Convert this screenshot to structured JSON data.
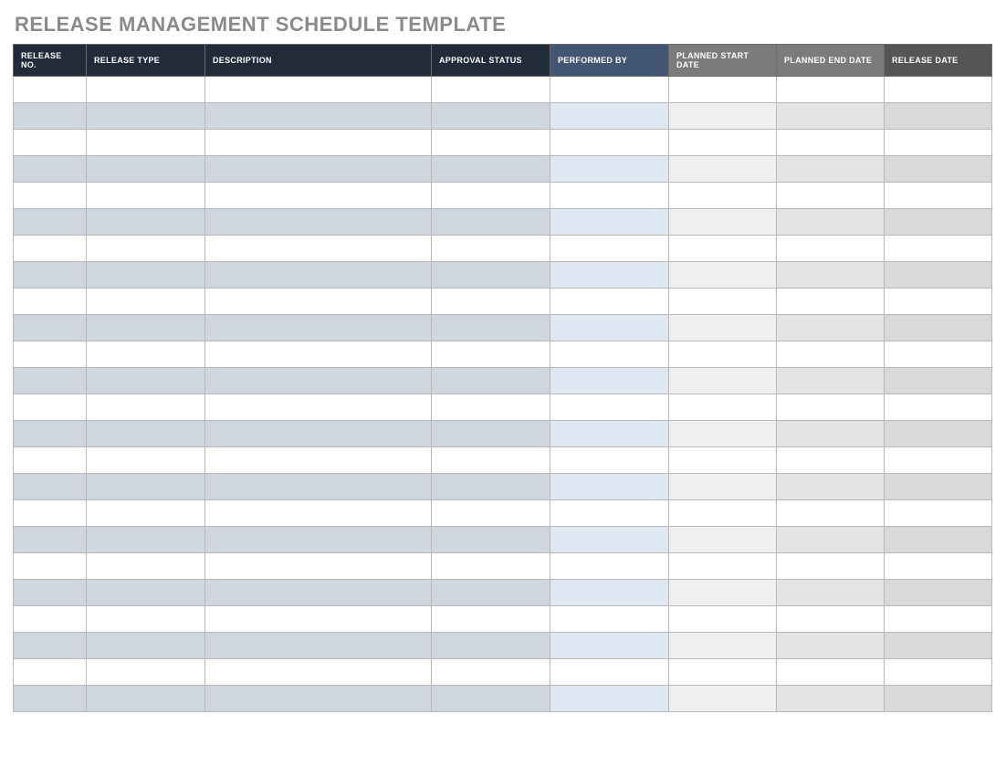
{
  "title": "RELEASE MANAGEMENT SCHEDULE TEMPLATE",
  "columns": [
    {
      "label": "RELEASE NO.",
      "group": "dark"
    },
    {
      "label": "RELEASE TYPE",
      "group": "dark"
    },
    {
      "label": "DESCRIPTION",
      "group": "dark"
    },
    {
      "label": "APPROVAL STATUS",
      "group": "dark"
    },
    {
      "label": "PERFORMED BY",
      "group": "blue"
    },
    {
      "label": "PLANNED START DATE",
      "group": "grey"
    },
    {
      "label": "PLANNED END DATE",
      "group": "grey"
    },
    {
      "label": "RELEASE DATE",
      "group": "darker"
    }
  ],
  "row_count": 24,
  "rows": [
    [
      "",
      "",
      "",
      "",
      "",
      "",
      "",
      ""
    ],
    [
      "",
      "",
      "",
      "",
      "",
      "",
      "",
      ""
    ],
    [
      "",
      "",
      "",
      "",
      "",
      "",
      "",
      ""
    ],
    [
      "",
      "",
      "",
      "",
      "",
      "",
      "",
      ""
    ],
    [
      "",
      "",
      "",
      "",
      "",
      "",
      "",
      ""
    ],
    [
      "",
      "",
      "",
      "",
      "",
      "",
      "",
      ""
    ],
    [
      "",
      "",
      "",
      "",
      "",
      "",
      "",
      ""
    ],
    [
      "",
      "",
      "",
      "",
      "",
      "",
      "",
      ""
    ],
    [
      "",
      "",
      "",
      "",
      "",
      "",
      "",
      ""
    ],
    [
      "",
      "",
      "",
      "",
      "",
      "",
      "",
      ""
    ],
    [
      "",
      "",
      "",
      "",
      "",
      "",
      "",
      ""
    ],
    [
      "",
      "",
      "",
      "",
      "",
      "",
      "",
      ""
    ],
    [
      "",
      "",
      "",
      "",
      "",
      "",
      "",
      ""
    ],
    [
      "",
      "",
      "",
      "",
      "",
      "",
      "",
      ""
    ],
    [
      "",
      "",
      "",
      "",
      "",
      "",
      "",
      ""
    ],
    [
      "",
      "",
      "",
      "",
      "",
      "",
      "",
      ""
    ],
    [
      "",
      "",
      "",
      "",
      "",
      "",
      "",
      ""
    ],
    [
      "",
      "",
      "",
      "",
      "",
      "",
      "",
      ""
    ],
    [
      "",
      "",
      "",
      "",
      "",
      "",
      "",
      ""
    ],
    [
      "",
      "",
      "",
      "",
      "",
      "",
      "",
      ""
    ],
    [
      "",
      "",
      "",
      "",
      "",
      "",
      "",
      ""
    ],
    [
      "",
      "",
      "",
      "",
      "",
      "",
      "",
      ""
    ],
    [
      "",
      "",
      "",
      "",
      "",
      "",
      "",
      ""
    ],
    [
      "",
      "",
      "",
      "",
      "",
      "",
      "",
      ""
    ]
  ]
}
